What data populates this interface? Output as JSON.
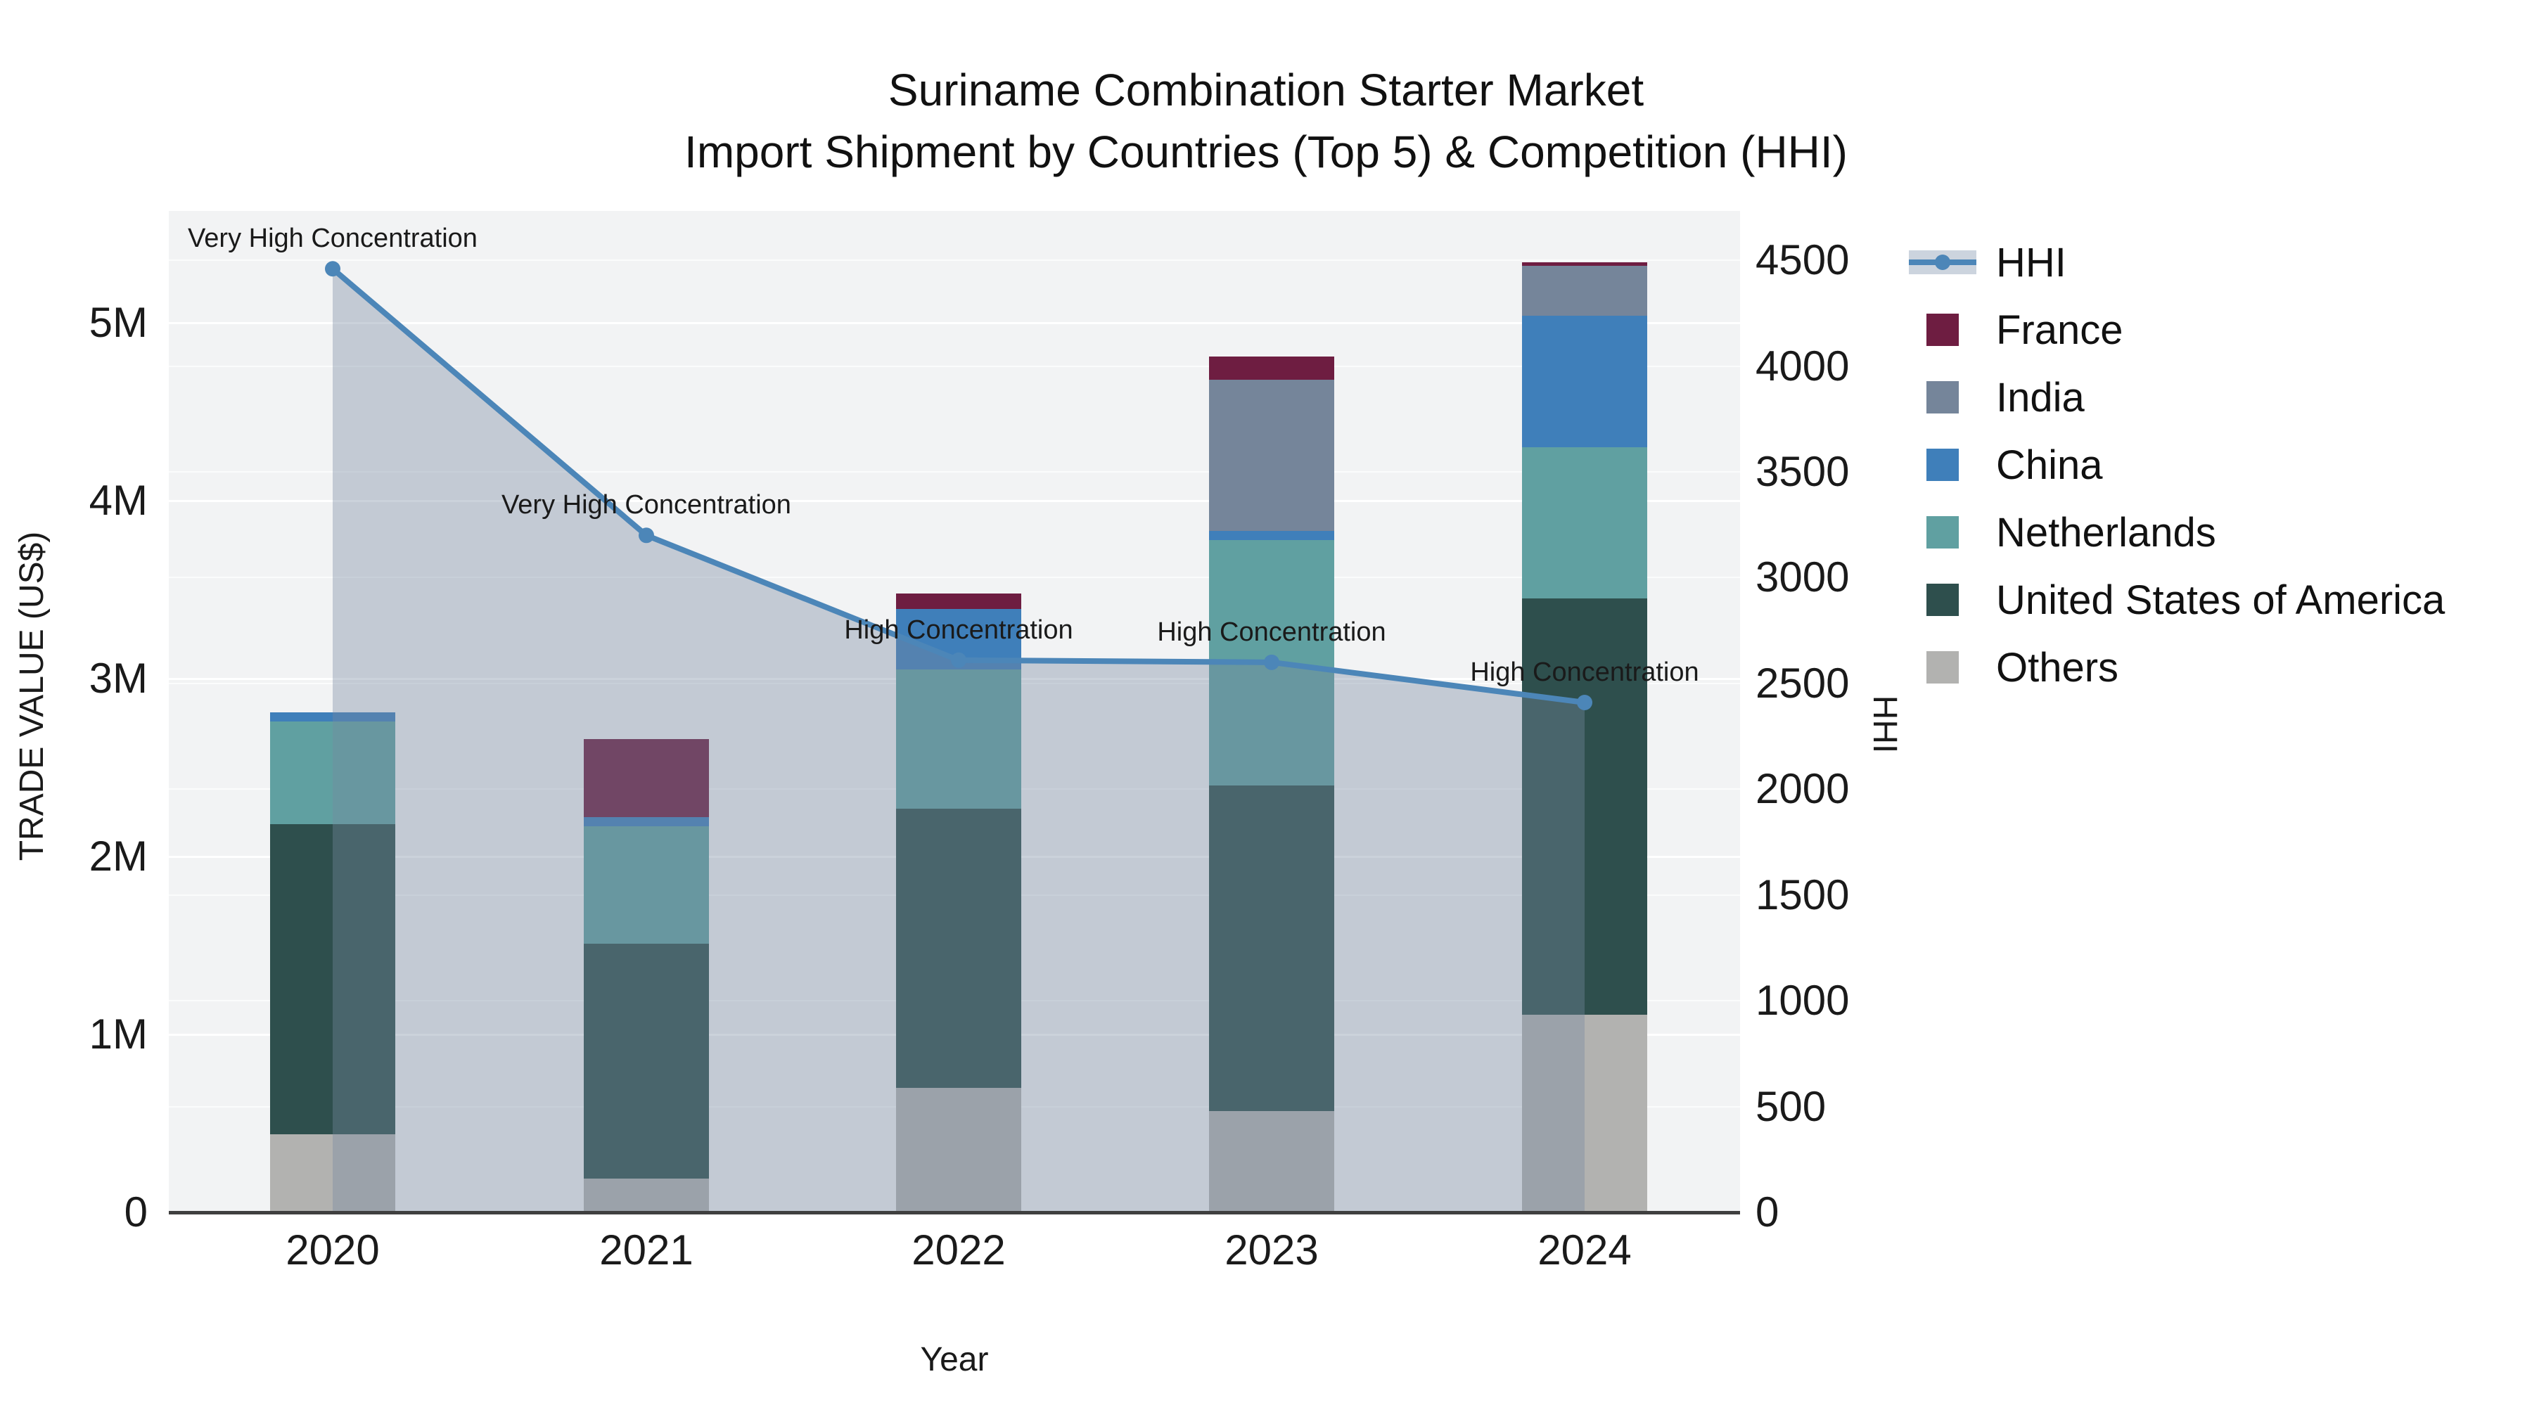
{
  "title": {
    "line1": "Suriname Combination Starter Market",
    "line2": "Import Shipment by Countries (Top 5) & Competition (HHI)"
  },
  "axes": {
    "x_label": "Year",
    "y_left_label": "TRADE VALUE (US$)",
    "y_right_label": "HHI",
    "y_left_ticks": [
      {
        "label": "0",
        "value": 0
      },
      {
        "label": "1M",
        "value": 1
      },
      {
        "label": "2M",
        "value": 2
      },
      {
        "label": "3M",
        "value": 3
      },
      {
        "label": "4M",
        "value": 4
      },
      {
        "label": "5M",
        "value": 5
      }
    ],
    "y_right_ticks": [
      0,
      500,
      1000,
      1500,
      2000,
      2500,
      3000,
      3500,
      4000,
      4500
    ],
    "y_left_range_M": [
      0,
      5.63
    ],
    "y_right_range": [
      0,
      4734
    ],
    "grid": "on"
  },
  "chart_data": {
    "type": "combo_stacked_bar_line",
    "categories": [
      "2020",
      "2021",
      "2022",
      "2023",
      "2024"
    ],
    "bar_value_unit": "US$ millions (TRADE VALUE)",
    "stack_order_bottom_to_top": [
      "Others",
      "United States of America",
      "Netherlands",
      "China",
      "India",
      "France"
    ],
    "series": [
      {
        "name": "Others",
        "color": "#B2B2B0",
        "values": [
          0.44,
          0.19,
          0.7,
          0.57,
          1.11
        ]
      },
      {
        "name": "United States of America",
        "color": "#2E4F4D",
        "values": [
          1.74,
          1.32,
          1.57,
          1.83,
          2.34
        ]
      },
      {
        "name": "Netherlands",
        "color": "#60A0A1",
        "values": [
          0.58,
          0.66,
          0.78,
          1.38,
          0.85
        ]
      },
      {
        "name": "China",
        "color": "#3F7FBA",
        "values": [
          0.05,
          0.05,
          0.34,
          0.05,
          0.74
        ]
      },
      {
        "name": "India",
        "color": "#75859A",
        "values": [
          0.0,
          0.0,
          0.0,
          0.85,
          0.28
        ]
      },
      {
        "name": "France",
        "color": "#6E1D41",
        "values": [
          0.0,
          0.44,
          0.09,
          0.13,
          0.02
        ]
      }
    ],
    "bar_totals_M": [
      2.81,
      2.66,
      3.48,
      4.81,
      5.35
    ],
    "line_series": {
      "name": "HHI",
      "axis": "right",
      "color": "#4C86B8",
      "area_fill": "rgba(118,136,161,0.38)",
      "values": [
        4460,
        3200,
        2610,
        2600,
        2410
      ]
    },
    "annotations": [
      {
        "category": "2020",
        "text": "Very High Concentration"
      },
      {
        "category": "2021",
        "text": "Very High Concentration"
      },
      {
        "category": "2022",
        "text": "High Concentration"
      },
      {
        "category": "2023",
        "text": "High Concentration"
      },
      {
        "category": "2024",
        "text": "High Concentration"
      }
    ],
    "legend_order": [
      "HHI",
      "France",
      "India",
      "China",
      "Netherlands",
      "United States of America",
      "Others"
    ],
    "legend_position": "right"
  },
  "colors": {
    "plot_background": "#f2f3f4",
    "figure_background": "#ffffff",
    "axis_line": "#3f3f3f",
    "gridline": "#ffffff",
    "text": "#1a1a1a",
    "hhi_line": "#4C86B8"
  }
}
